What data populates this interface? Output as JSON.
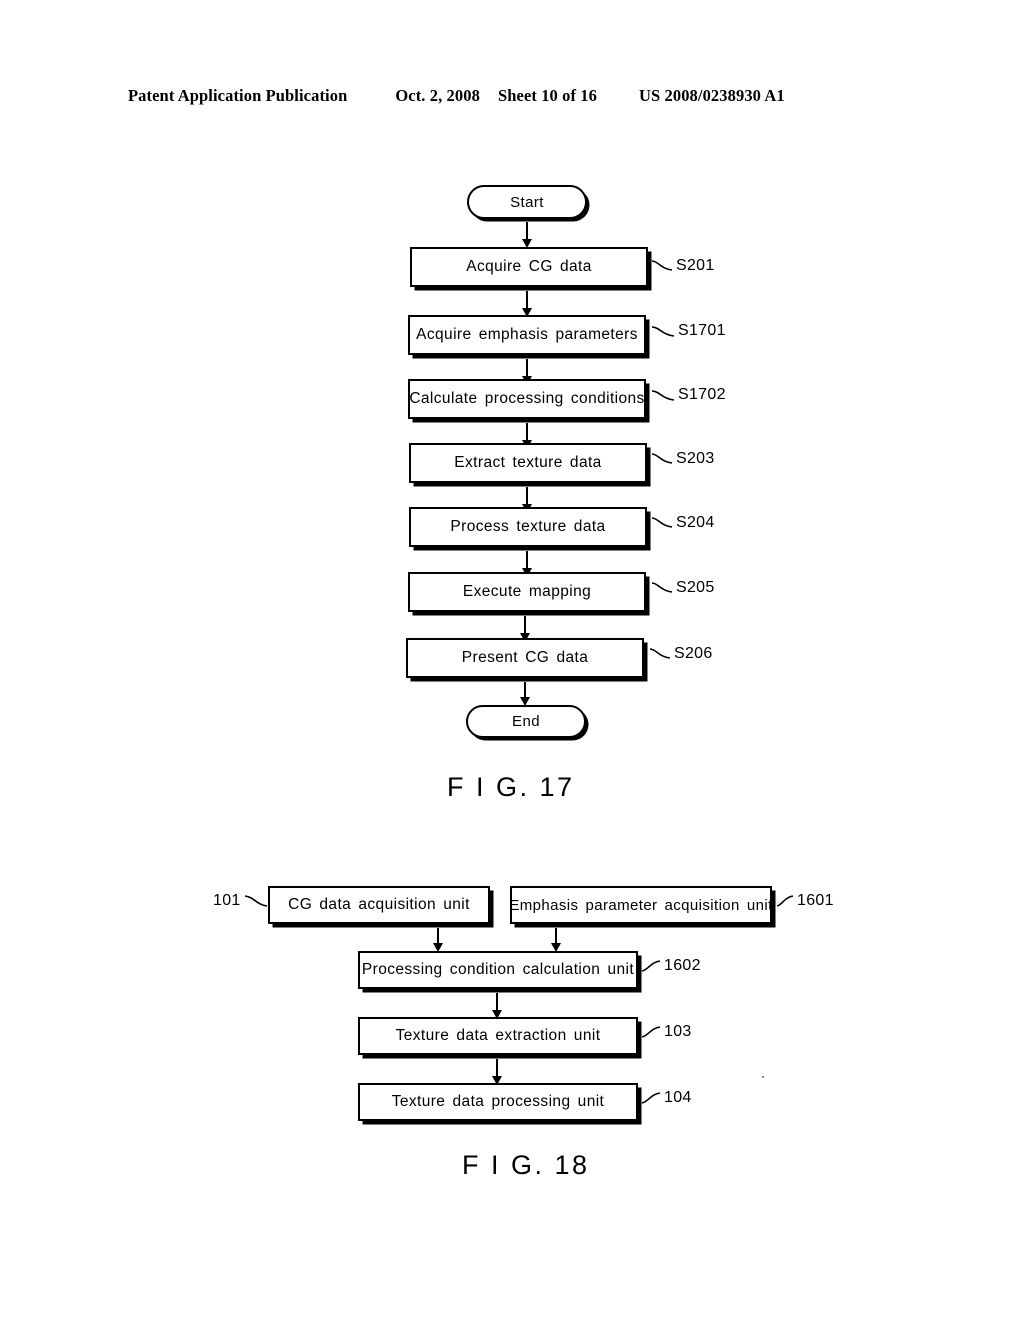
{
  "header": {
    "publication": "Patent Application Publication",
    "date": "Oct. 2, 2008",
    "sheet": "Sheet 10 of 16",
    "patent_number": "US 2008/0238930 A1"
  },
  "figures": [
    {
      "caption": "F I G. 17",
      "type": "flowchart",
      "nodes": [
        {
          "id": "start",
          "label": "Start",
          "shape": "terminal",
          "ref": null
        },
        {
          "id": "s201",
          "label": "Acquire CG data",
          "shape": "process",
          "ref": "S201"
        },
        {
          "id": "s1701",
          "label": "Acquire emphasis parameters",
          "shape": "process",
          "ref": "S1701"
        },
        {
          "id": "s1702",
          "label": "Calculate processing conditions",
          "shape": "process",
          "ref": "S1702"
        },
        {
          "id": "s203",
          "label": "Extract texture data",
          "shape": "process",
          "ref": "S203"
        },
        {
          "id": "s204",
          "label": "Process texture data",
          "shape": "process",
          "ref": "S204"
        },
        {
          "id": "s205",
          "label": "Execute mapping",
          "shape": "process",
          "ref": "S205"
        },
        {
          "id": "s206",
          "label": "Present CG data",
          "shape": "process",
          "ref": "S206"
        },
        {
          "id": "end",
          "label": "End",
          "shape": "terminal",
          "ref": null
        }
      ]
    },
    {
      "caption": "F I G. 18",
      "type": "block-diagram",
      "nodes": [
        {
          "id": "b101",
          "label": "CG data acquisition unit",
          "ref": "101",
          "ref_side": "left"
        },
        {
          "id": "b1601",
          "label": "Emphasis parameter acquisition unit",
          "ref": "1601",
          "ref_side": "right"
        },
        {
          "id": "b1602",
          "label": "Processing condition calculation unit",
          "ref": "1602",
          "ref_side": "right"
        },
        {
          "id": "b103",
          "label": "Texture data extraction unit",
          "ref": "103",
          "ref_side": "right"
        },
        {
          "id": "b104",
          "label": "Texture data processing unit",
          "ref": "104",
          "ref_side": "right"
        }
      ]
    }
  ]
}
